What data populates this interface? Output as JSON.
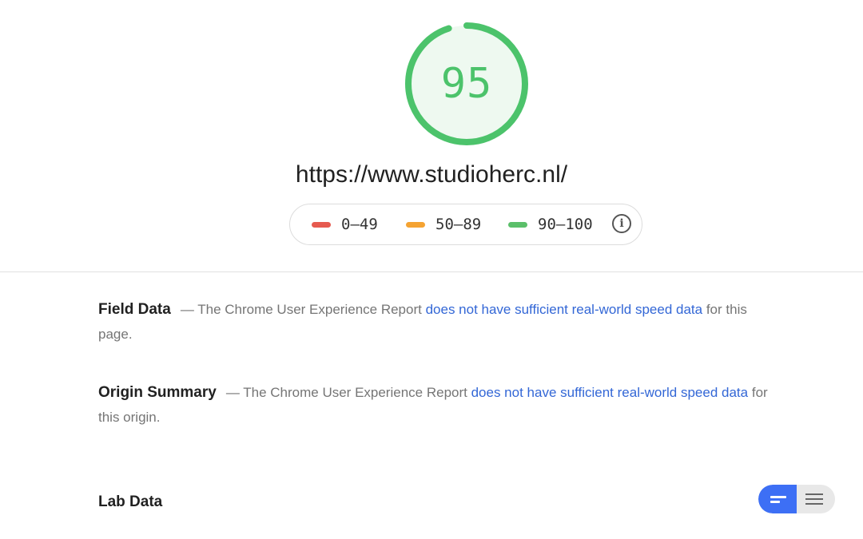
{
  "score": {
    "value": "95",
    "fraction": 0.95,
    "color": "#4cc36b",
    "track_color": "#eef9f0"
  },
  "url": "https://www.studioherc.nl/",
  "legend": {
    "items": [
      {
        "label": "0–49",
        "color": "#e65a4f"
      },
      {
        "label": "50–89",
        "color": "#f5a332"
      },
      {
        "label": "90–100",
        "color": "#5bbf6a"
      }
    ],
    "info_icon": "info-icon"
  },
  "field_data": {
    "heading": "Field Data",
    "prefix": "— The Chrome User Experience Report ",
    "link": "does not have sufficient real-world speed data",
    "suffix": " for this page."
  },
  "origin_summary": {
    "heading": "Origin Summary",
    "prefix": "— The Chrome User Experience Report ",
    "link": "does not have sufficient real-world speed data",
    "suffix": " for this origin."
  },
  "lab_data": {
    "heading": "Lab Data",
    "toggle_active_color": "#3d6ff5"
  }
}
